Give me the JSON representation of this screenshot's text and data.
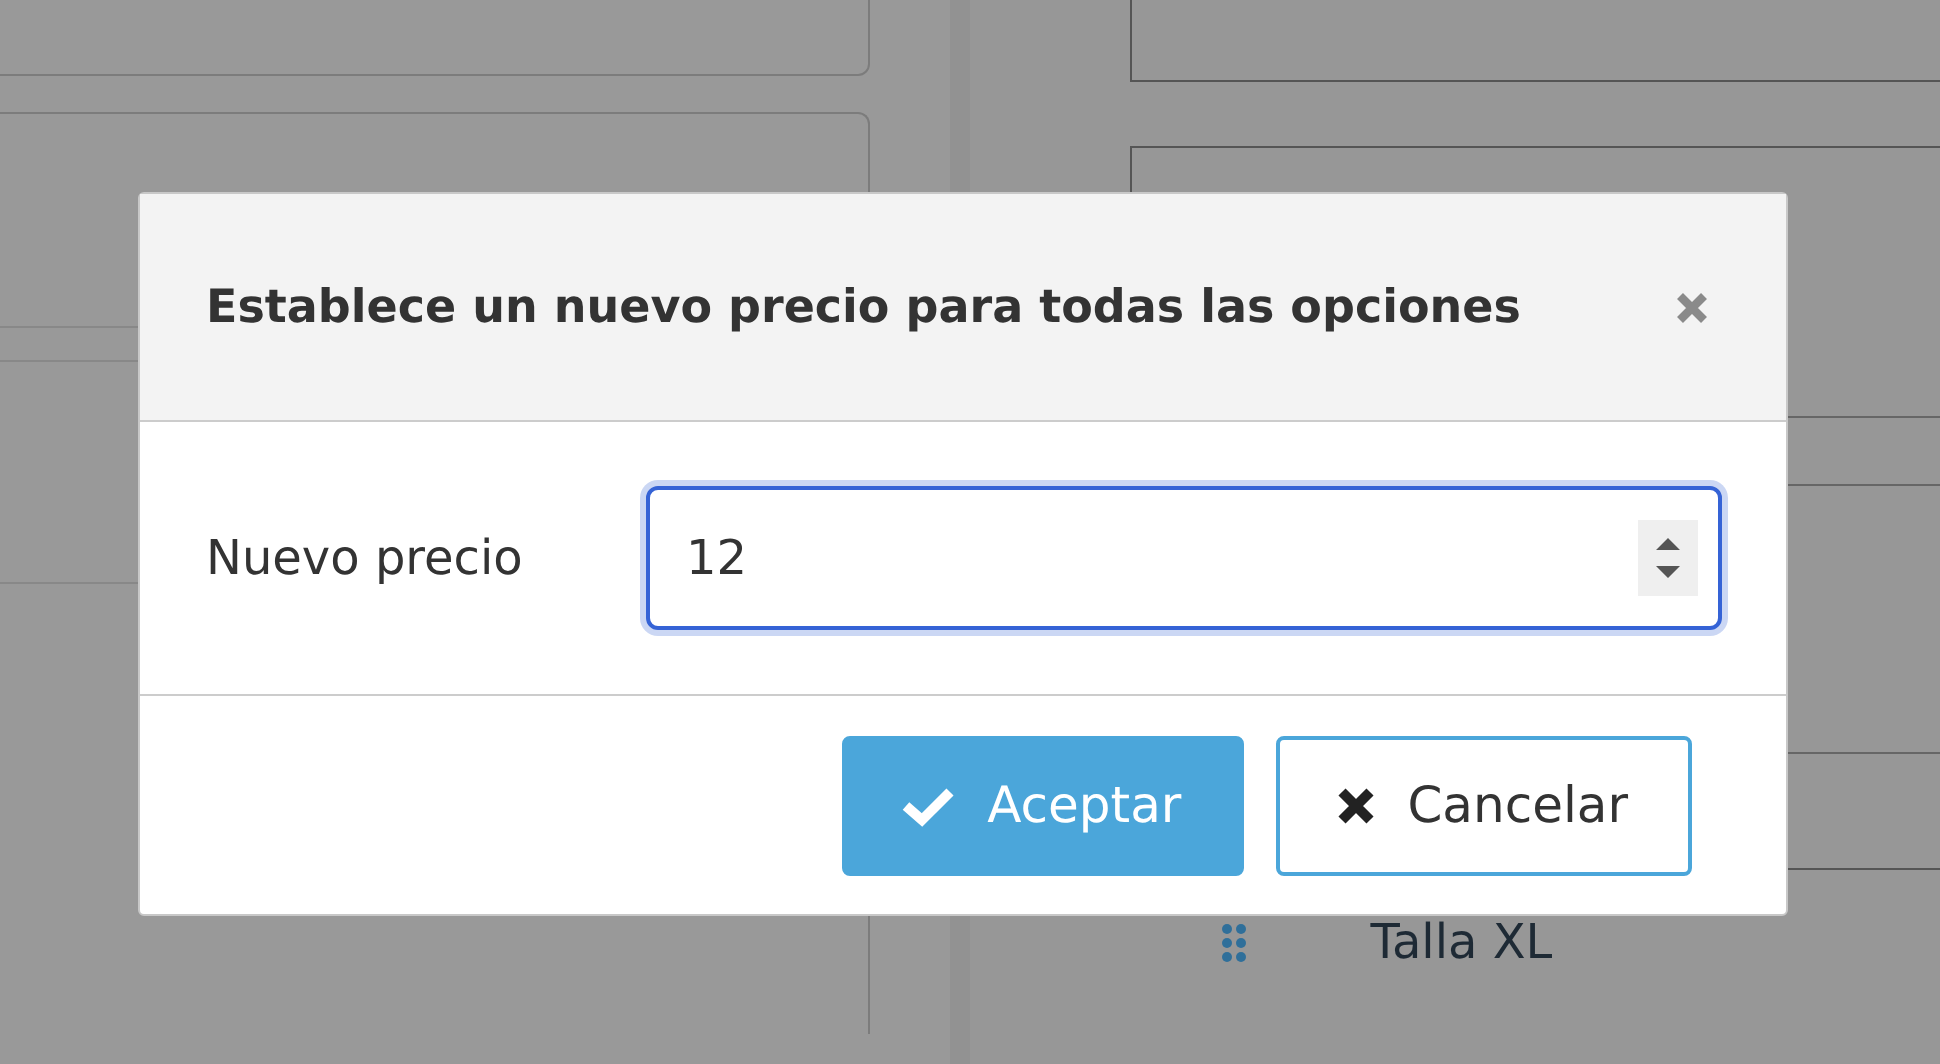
{
  "background": {
    "items": [
      {
        "label": "Talla XL"
      }
    ]
  },
  "dialog": {
    "title": "Establece un nuevo precio para todas las opciones",
    "fields": [
      {
        "label": "Nuevo precio",
        "value": "12",
        "focused": true
      }
    ],
    "buttons": [
      {
        "label": "Aceptar",
        "kind": "primary"
      },
      {
        "label": "Cancelar",
        "kind": "secondary"
      }
    ]
  }
}
